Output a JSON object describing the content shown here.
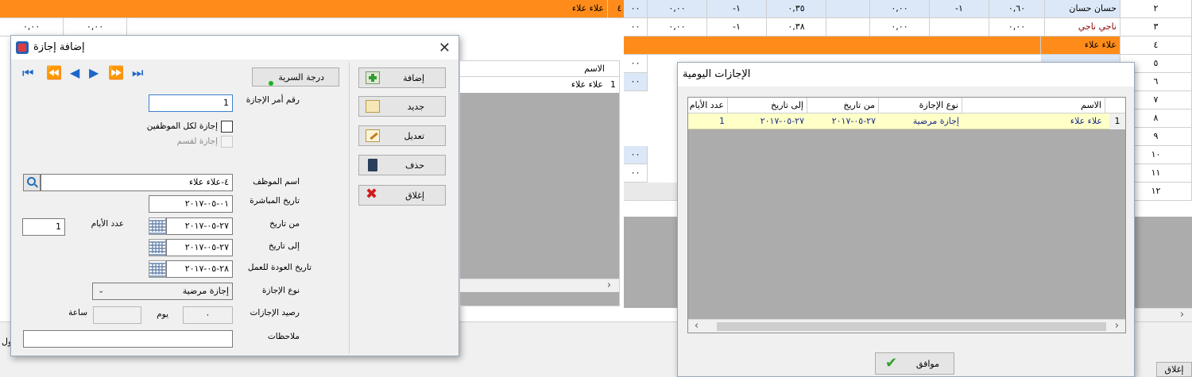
{
  "background": {
    "rows": [
      {
        "no": "٢",
        "name": "حسان حسان",
        "c1": "٠,٦٠",
        "c2": "-١",
        "c3": "٠,٠٠",
        "c4": "٠,٣٥",
        "c5": "-١",
        "c6": "٠,٠٠",
        "c7": "٠٠",
        "left_name": "علاء علاء",
        "left_no": "٤"
      },
      {
        "no": "٣",
        "name": "ناجي ناجي",
        "c1": "٠,٠٠",
        "c2": "",
        "c3": "٠,٠٠",
        "c4": "٠,٣٨",
        "c5": "-١",
        "c6": "٠,٠٠",
        "c7": "٠٠",
        "l1": "٠,٠٠",
        "l2": "٠,٠٠"
      },
      {
        "no": "٤",
        "name": "علاء علاء"
      },
      {
        "no": "٥"
      },
      {
        "no": "٦"
      },
      {
        "no": "٧"
      },
      {
        "no": "٨"
      },
      {
        "no": "٩"
      },
      {
        "no": "١٠"
      },
      {
        "no": "١١"
      },
      {
        "no": "١٢"
      }
    ],
    "side_vals": [
      "٠٠",
      "٠٠",
      "٠٠",
      "٠٠",
      "٠٠"
    ],
    "bottom_left": "ول",
    "bottom_right": "إغلاق"
  },
  "add_leave": {
    "title": "إضافة إجازة",
    "nav": [
      "first",
      "prev-page",
      "prev",
      "next",
      "next-page",
      "last"
    ],
    "buttons": {
      "add": "إضافة",
      "new": "جديد",
      "edit": "تعديل",
      "delete": "حذف",
      "close": "إغلاق"
    },
    "secrecy_label": "درجة السرية",
    "order_no_label": "رقم أمر الإجازة",
    "order_no": "1",
    "all_employees_label": "إجازة لكل الموظفين",
    "department_label": "إجازة لقسم",
    "employee_name_label": "اسم الموظف",
    "employee_name": "٤-علاء علاء",
    "start_date_label": "تاريخ المباشرة",
    "start_date": "٠١-٠٥-٢٠١٧",
    "from_date_label": "من تاريخ",
    "from_date": "٢٧-٠٥-٢٠١٧",
    "to_date_label": "إلى تاريخ",
    "to_date": "٢٧-٠٥-٢٠١٧",
    "return_date_label": "تاريخ العودة للعمل",
    "return_date": "٢٨-٠٥-٢٠١٧",
    "days_label": "عدد الأيام",
    "days": "1",
    "leave_type_label": "نوع الإجازة",
    "leave_type": "إجازة مرضية",
    "balance_label": "رصيد الإجازات",
    "day_label": "يوم",
    "day_value": "٠",
    "hour_label": "ساعة",
    "notes_label": "ملاحظات",
    "side_grid": {
      "header": "الاسم",
      "row_no": "1",
      "row_name": "علاء علاء"
    }
  },
  "daily_leaves": {
    "title": "الإجازات اليومية",
    "columns": [
      "الاسم",
      "نوع الإجازة",
      "من تاريخ",
      "إلى تاريخ",
      "عدد الأيام"
    ],
    "rows": [
      {
        "no": "1",
        "name": "علاء علاء",
        "type": "إجازة مرضية",
        "from": "٢٧-٠٥-٢٠١٧",
        "to": "٢٧-٠٥-٢٠١٧",
        "days": "1"
      }
    ],
    "ok_label": "موافق"
  },
  "colors": {
    "highlight": "#ff8c1a",
    "selected_row": "#ffffc8",
    "nav_blue": "#1e66c8"
  }
}
